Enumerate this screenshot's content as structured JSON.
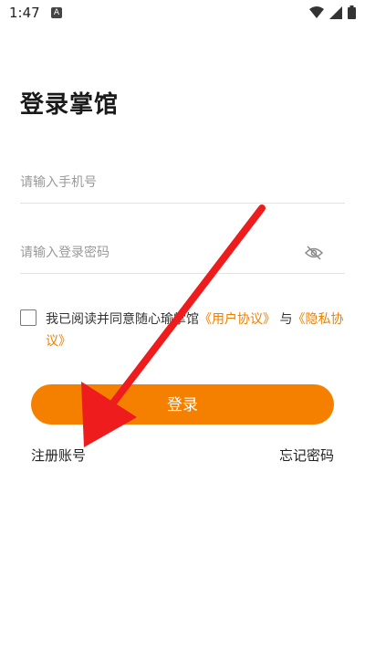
{
  "status_bar": {
    "time": "1:47",
    "notification_letter": "A"
  },
  "page": {
    "title": "登录掌馆"
  },
  "form": {
    "phone_placeholder": "请输入手机号",
    "password_placeholder": "请输入登录密码"
  },
  "agreement": {
    "prefix": "我已阅读并同意随心瑜掌馆",
    "user_agreement": "《用户协议》",
    "and": "与",
    "privacy_policy": "《隐私协议》",
    "checked": false
  },
  "actions": {
    "login_label": "登录",
    "register_label": "注册账号",
    "forgot_label": "忘记密码"
  },
  "colors": {
    "accent": "#f58000",
    "link": "#f07f00",
    "annotation_arrow": "#ee1c1c"
  },
  "icons": {
    "password_visibility": "eye-off-icon"
  }
}
